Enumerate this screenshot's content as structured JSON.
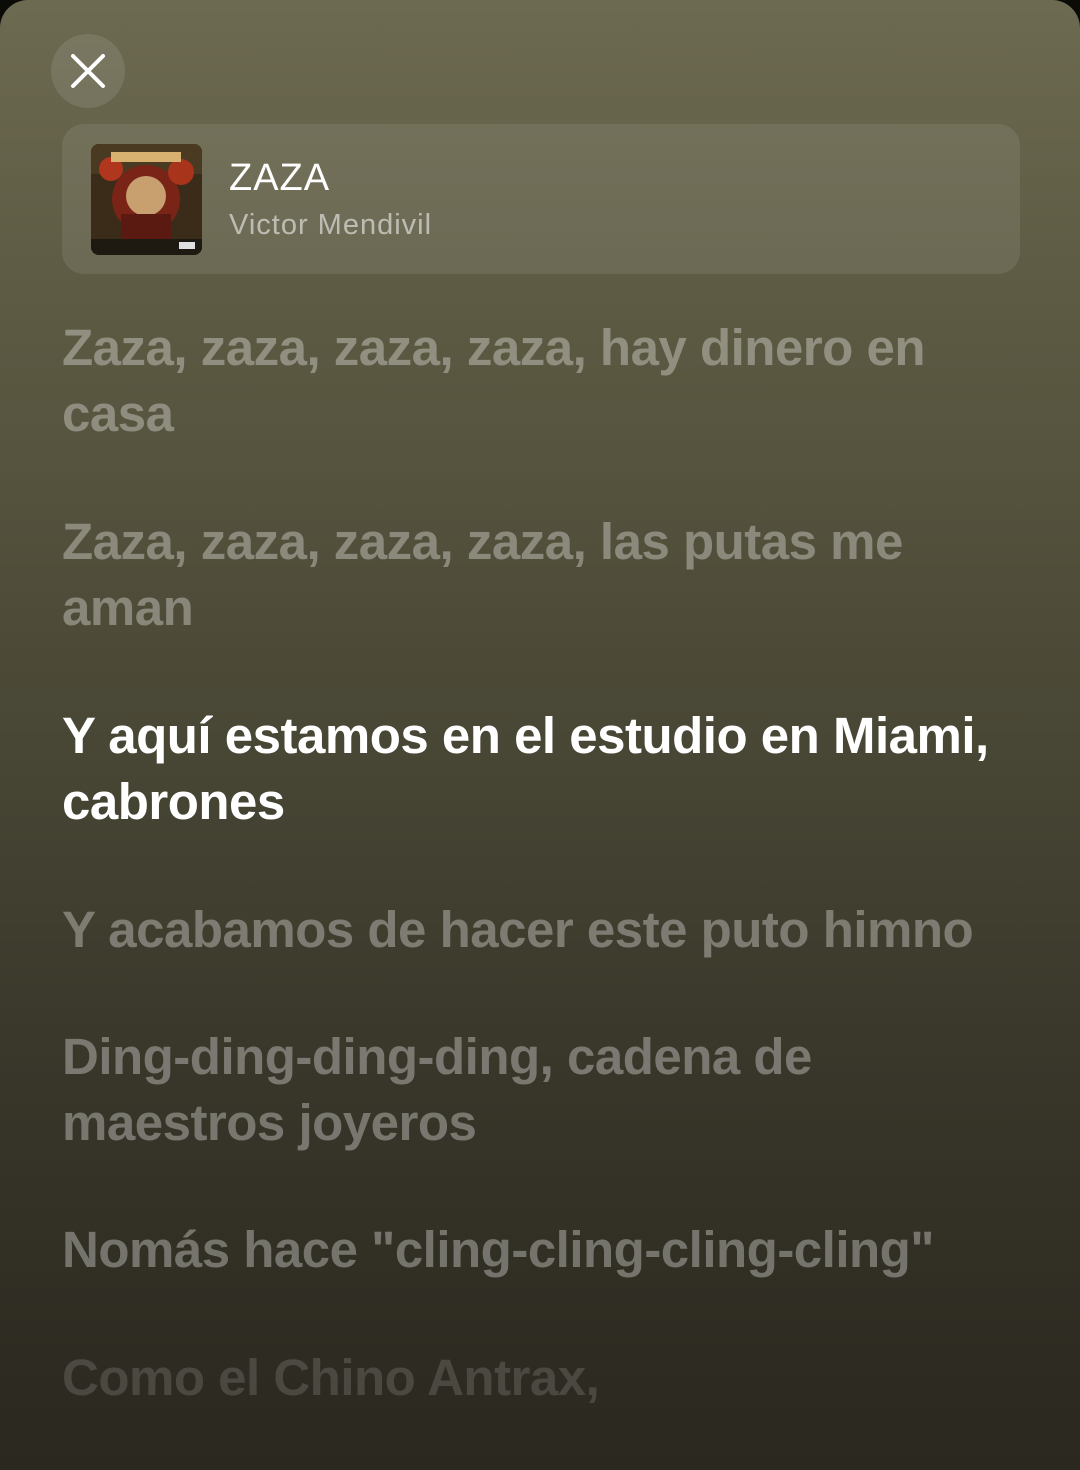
{
  "close_button": {
    "icon": "close-icon"
  },
  "now_playing": {
    "artwork": "album-artwork",
    "title": "ZAZA",
    "artist": "Victor Mendivil"
  },
  "lyrics": [
    {
      "text": "Zaza, zaza, zaza, zaza, hay dinero en casa",
      "state": "past"
    },
    {
      "text": "Zaza, zaza, zaza, zaza, las putas me aman",
      "state": "past"
    },
    {
      "text": "Y aquí estamos en el estudio en Miami, cabrones",
      "state": "current"
    },
    {
      "text": "Y acabamos de hacer este puto himno",
      "state": "upcoming"
    },
    {
      "text": "Ding-ding-ding-ding, cadena de maestros joyeros",
      "state": "upcoming"
    },
    {
      "text": "Nomás hace \"cling-cling-cling-cling\"",
      "state": "upcoming"
    },
    {
      "text": "Como el Chino Antrax,",
      "state": "faded"
    }
  ],
  "colors": {
    "background_top": "#6c6a50",
    "background_bottom": "#2a281f",
    "active_lyric": "#ffffff"
  }
}
